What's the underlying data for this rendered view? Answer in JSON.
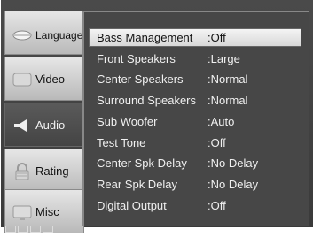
{
  "sidebar": {
    "items": [
      {
        "label": "Language",
        "icon": "lips-icon"
      },
      {
        "label": "Video",
        "icon": "monitor-icon"
      },
      {
        "label": "Audio",
        "icon": "speaker-icon"
      },
      {
        "label": "Rating",
        "icon": "lock-icon"
      },
      {
        "label": "Misc",
        "icon": "tv-icon"
      }
    ],
    "active": "Audio"
  },
  "settings": [
    {
      "name": "Bass Management",
      "value": ":Off"
    },
    {
      "name": "Front Speakers",
      "value": ":Large"
    },
    {
      "name": "Center Speakers",
      "value": ":Normal"
    },
    {
      "name": "Surround Speakers",
      "value": ":Normal"
    },
    {
      "name": "Sub Woofer",
      "value": ":Auto"
    },
    {
      "name": "Test Tone",
      "value": ":Off"
    },
    {
      "name": "Center Spk Delay",
      "value": ":No Delay"
    },
    {
      "name": "Rear Spk Delay",
      "value": ":No Delay"
    },
    {
      "name": "Digital Output",
      "value": ":Off"
    }
  ],
  "colors": {
    "selected_row": "#e8e8e8",
    "panel": "#474747",
    "active_tab": "#4e4e4e"
  }
}
